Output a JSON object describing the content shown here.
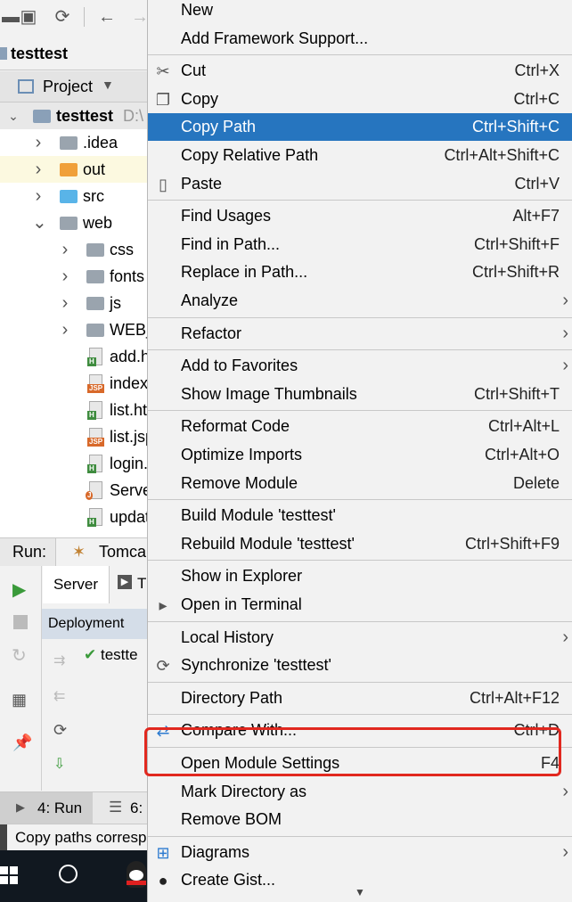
{
  "project_view": {
    "root_crumb": "testtest",
    "view_selector": "Project",
    "root": {
      "name": "testtest",
      "path_hint": "D:\\"
    },
    "items": [
      {
        "label": ".idea",
        "kind": "folder",
        "depth": 1
      },
      {
        "label": "out",
        "kind": "folder-orange",
        "depth": 1
      },
      {
        "label": "src",
        "kind": "folder-blue",
        "depth": 1
      },
      {
        "label": "web",
        "kind": "folder-web",
        "depth": 1
      },
      {
        "label": "css",
        "kind": "folder",
        "depth": 2
      },
      {
        "label": "fonts",
        "kind": "folder",
        "depth": 2
      },
      {
        "label": "js",
        "kind": "folder",
        "depth": 2
      },
      {
        "label": "WEB_",
        "kind": "folder",
        "depth": 2
      },
      {
        "label": "add.h",
        "kind": "html",
        "depth": 2
      },
      {
        "label": "index",
        "kind": "jsp",
        "depth": 2
      },
      {
        "label": "list.ht",
        "kind": "html",
        "depth": 2
      },
      {
        "label": "list.jsp",
        "kind": "jsp",
        "depth": 2
      },
      {
        "label": "login.",
        "kind": "html",
        "depth": 2
      },
      {
        "label": "Serve",
        "kind": "java",
        "depth": 2
      },
      {
        "label": "updat",
        "kind": "html",
        "depth": 2
      }
    ]
  },
  "run_panel": {
    "run_label": "Run:",
    "config_name": "Tomca",
    "tab_server": "Server",
    "tab_t": "T",
    "deployment_header": "Deployment",
    "deployment_item": "testte"
  },
  "bottom_tabs": {
    "run": "4: Run",
    "todo": "6:"
  },
  "status_bar": {
    "text": "Copy paths corresp"
  },
  "context_menu": {
    "groups": [
      [
        {
          "label": "New",
          "shortcut": "",
          "submenu": false,
          "icon": ""
        },
        {
          "label": "Add Framework Support...",
          "shortcut": "",
          "submenu": false,
          "icon": ""
        }
      ],
      [
        {
          "label": "Cut",
          "shortcut": "Ctrl+X",
          "submenu": false,
          "icon": "scissors-icon"
        },
        {
          "label": "Copy",
          "shortcut": "Ctrl+C",
          "submenu": false,
          "icon": "copy-icon"
        },
        {
          "label": "Copy Path",
          "shortcut": "Ctrl+Shift+C",
          "submenu": false,
          "icon": "",
          "selected": true
        },
        {
          "label": "Copy Relative Path",
          "shortcut": "Ctrl+Alt+Shift+C",
          "submenu": false,
          "icon": ""
        },
        {
          "label": "Paste",
          "shortcut": "Ctrl+V",
          "submenu": false,
          "icon": "clipboard-icon"
        }
      ],
      [
        {
          "label": "Find Usages",
          "shortcut": "Alt+F7",
          "submenu": false,
          "icon": ""
        },
        {
          "label": "Find in Path...",
          "shortcut": "Ctrl+Shift+F",
          "submenu": false,
          "icon": ""
        },
        {
          "label": "Replace in Path...",
          "shortcut": "Ctrl+Shift+R",
          "submenu": false,
          "icon": ""
        },
        {
          "label": "Analyze",
          "shortcut": "",
          "submenu": true,
          "icon": ""
        }
      ],
      [
        {
          "label": "Refactor",
          "shortcut": "",
          "submenu": true,
          "icon": ""
        }
      ],
      [
        {
          "label": "Add to Favorites",
          "shortcut": "",
          "submenu": true,
          "icon": ""
        },
        {
          "label": "Show Image Thumbnails",
          "shortcut": "Ctrl+Shift+T",
          "submenu": false,
          "icon": ""
        }
      ],
      [
        {
          "label": "Reformat Code",
          "shortcut": "Ctrl+Alt+L",
          "submenu": false,
          "icon": ""
        },
        {
          "label": "Optimize Imports",
          "shortcut": "Ctrl+Alt+O",
          "submenu": false,
          "icon": ""
        },
        {
          "label": "Remove Module",
          "shortcut": "Delete",
          "submenu": false,
          "icon": ""
        }
      ],
      [
        {
          "label": "Build Module 'testtest'",
          "shortcut": "",
          "submenu": false,
          "icon": ""
        },
        {
          "label": "Rebuild Module 'testtest'",
          "shortcut": "Ctrl+Shift+F9",
          "submenu": false,
          "icon": ""
        }
      ],
      [
        {
          "label": "Show in Explorer",
          "shortcut": "",
          "submenu": false,
          "icon": ""
        },
        {
          "label": "Open in Terminal",
          "shortcut": "",
          "submenu": false,
          "icon": "terminal-icon"
        }
      ],
      [
        {
          "label": "Local History",
          "shortcut": "",
          "submenu": true,
          "icon": ""
        },
        {
          "label": "Synchronize 'testtest'",
          "shortcut": "",
          "submenu": false,
          "icon": "sync-icon"
        }
      ],
      [
        {
          "label": "Directory Path",
          "shortcut": "Ctrl+Alt+F12",
          "submenu": false,
          "icon": ""
        }
      ],
      [
        {
          "label": "Compare With...",
          "shortcut": "Ctrl+D",
          "submenu": false,
          "icon": "compare-icon"
        }
      ],
      [
        {
          "label": "Open Module Settings",
          "shortcut": "F4",
          "submenu": false,
          "icon": "",
          "highlighted_red": true
        },
        {
          "label": "Mark Directory as",
          "shortcut": "",
          "submenu": true,
          "icon": ""
        },
        {
          "label": "Remove BOM",
          "shortcut": "",
          "submenu": false,
          "icon": ""
        }
      ],
      [
        {
          "label": "Diagrams",
          "shortcut": "",
          "submenu": true,
          "icon": "diagram-icon"
        },
        {
          "label": "Create Gist...",
          "shortcut": "",
          "submenu": false,
          "icon": "github-icon"
        }
      ]
    ],
    "more_arrow": "▼"
  },
  "colors": {
    "selection": "#2675bf",
    "annotation_red": "#e1281f",
    "tree_highlight": "#fcf9e0"
  }
}
